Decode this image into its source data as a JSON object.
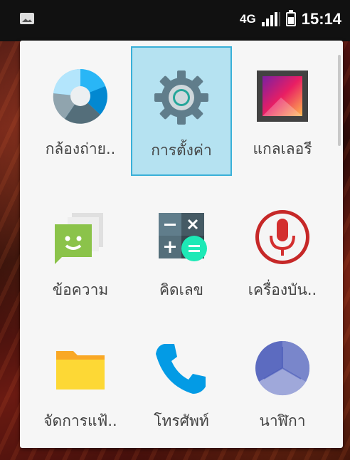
{
  "status_bar": {
    "network": "4G",
    "time": "15:14"
  },
  "apps": [
    {
      "id": "camera",
      "label": "กล้องถ่าย.."
    },
    {
      "id": "settings",
      "label": "การตั้งค่า",
      "selected": true
    },
    {
      "id": "gallery",
      "label": "แกลเลอรี"
    },
    {
      "id": "messaging",
      "label": "ข้อความ"
    },
    {
      "id": "calculator",
      "label": "คิดเลข"
    },
    {
      "id": "recorder",
      "label": "เครื่องบัน.."
    },
    {
      "id": "file-manager",
      "label": "จัดการแฟ้.."
    },
    {
      "id": "phone",
      "label": "โทรศัพท์"
    },
    {
      "id": "clock",
      "label": "นาฬิกา"
    }
  ],
  "colors": {
    "selection_fill": "#b5e2f1",
    "selection_border": "#3ab0d8"
  }
}
